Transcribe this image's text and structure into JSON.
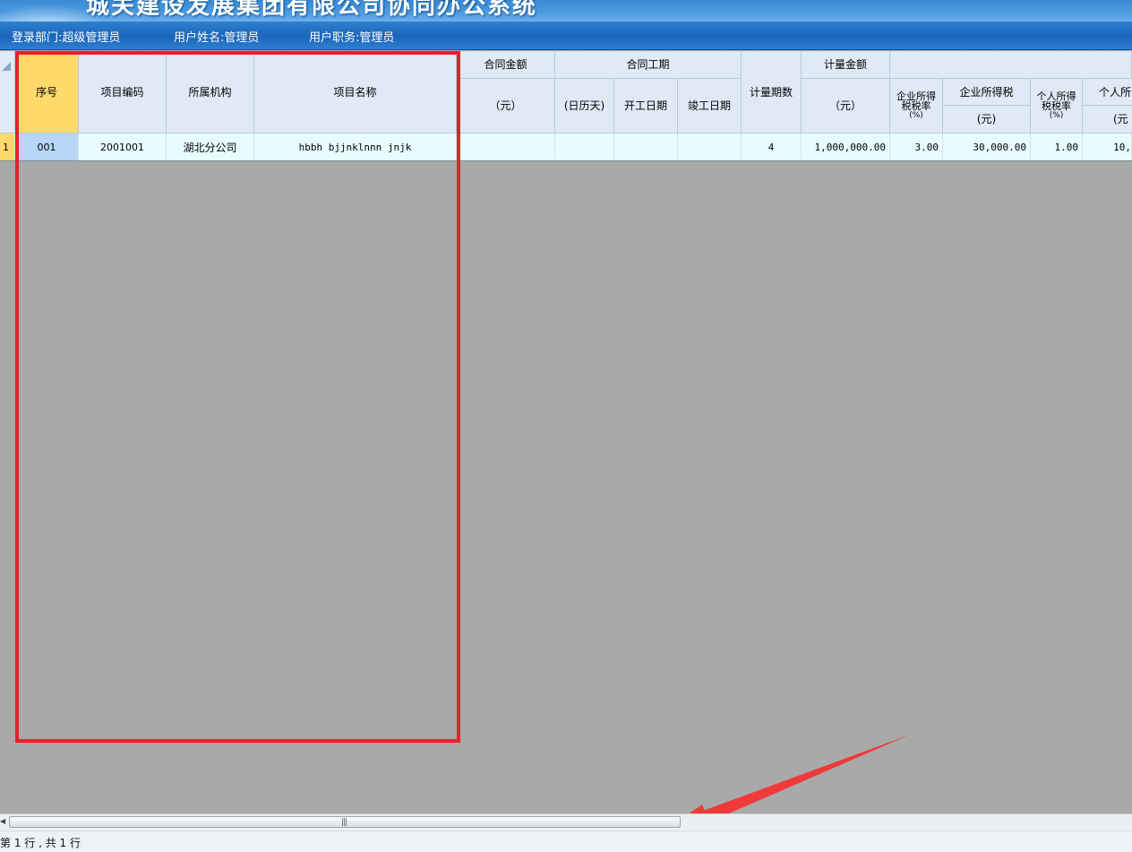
{
  "app": {
    "title": "城关建设发展集团有限公司协同办公系统"
  },
  "user_bar": {
    "department": "登录部门:超级管理员",
    "user_name": "用户姓名:管理员",
    "user_role": "用户职务:管理员"
  },
  "grid": {
    "headers": {
      "seq": "序号",
      "project_code": "项目编码",
      "organization": "所属机构",
      "project_name": "项目名称",
      "contract_amount": "合同金额",
      "contract_amount_unit": "（元）",
      "contract_period": "合同工期",
      "calendar_days": "(日历天)",
      "start_date": "开工日期",
      "end_date": "竣工日期",
      "measure_periods": "计量期数",
      "measure_amount": "计量金额",
      "measure_amount_unit": "（元）",
      "corp_tax_rate_1": "企业所得",
      "corp_tax_rate_2": "税税率",
      "corp_tax_rate_3": "(%)",
      "corp_tax": "企业所得税",
      "corp_tax_unit": "(元)",
      "personal_tax_rate_1": "个人所得",
      "personal_tax_rate_2": "税税率",
      "personal_tax_rate_3": "(%)",
      "personal_tax": "个人所",
      "personal_tax_unit": "(元"
    },
    "rows": [
      {
        "row_number": "1",
        "seq": "001",
        "project_code": "2001001",
        "organization": "湖北分公司",
        "project_name": "hbbh bjjnklnnn  jnjk",
        "contract_amount": "",
        "calendar_days": "",
        "start_date": "",
        "end_date": "",
        "measure_periods": "4",
        "measure_amount": "1,000,000.00",
        "corp_tax_rate": "3.00",
        "corp_tax": "30,000.00",
        "personal_tax_rate": "1.00",
        "personal_tax": "10,"
      }
    ]
  },
  "status_bar": {
    "text": "第 1 行 , 共 1 行"
  },
  "colors": {
    "annotation_red": "#e8202a",
    "selected_header": "#ffd96a",
    "selected_cell": "#b6d7f5"
  }
}
